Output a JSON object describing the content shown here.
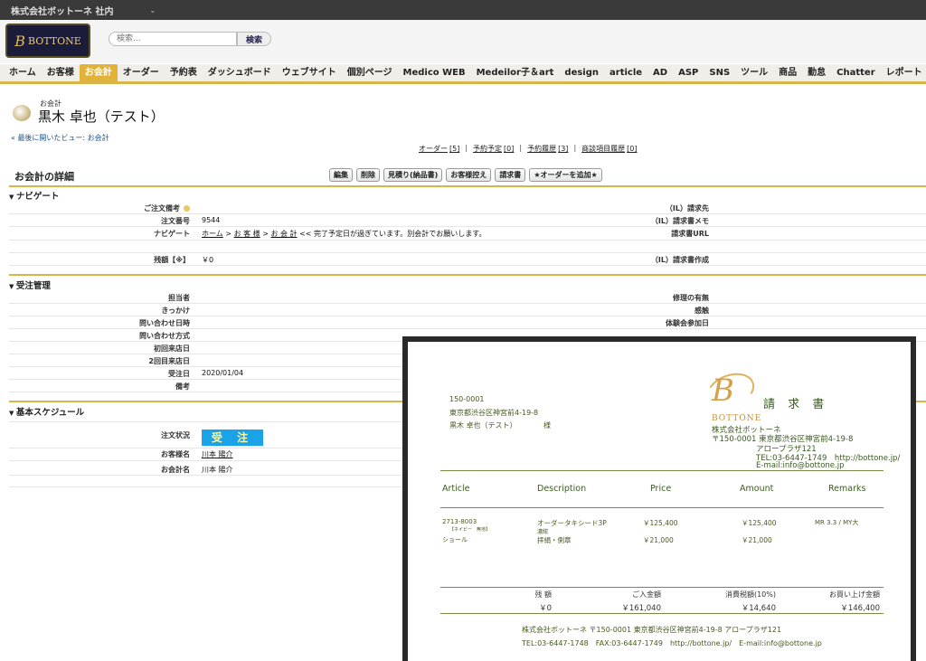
{
  "topbar": {
    "org_name": "株式会社ボットーネ 社内",
    "caret": "⌄"
  },
  "header": {
    "logo_mark": "B",
    "logo_text": "BOTTONE",
    "search_placeholder": "検索...",
    "search_button": "検索"
  },
  "nav": {
    "tabs": [
      "ホーム",
      "お客様",
      "お会計",
      "オーダー",
      "予約表",
      "ダッシュボード",
      "ウェブサイト",
      "個別ページ",
      "Medico WEB",
      "Medeilor子＆art",
      "design",
      "article",
      "AD",
      "ASP",
      "SNS",
      "ツール",
      "商品",
      "勤怠",
      "Chatter",
      "レポート",
      "仕入業者"
    ],
    "active": "お会計"
  },
  "page": {
    "subtitle": "お会計",
    "title": "黒木 卓也（テスト）",
    "back_link": "« 最後に開いたビュー: お会計"
  },
  "related": [
    {
      "label": "オーダー",
      "count": "[5]"
    },
    {
      "label": "予約予定",
      "count": "[0]"
    },
    {
      "label": "予約履歴",
      "count": "[3]"
    },
    {
      "label": "商談項目履歴",
      "count": "[0]"
    }
  ],
  "detail": {
    "title": "お会計の詳細",
    "buttons": [
      "編集",
      "削除",
      "見積り(納品書)",
      "お客様控え",
      "請求書",
      "★オーダーを追加★"
    ]
  },
  "sections": {
    "navigate": {
      "title": "ナビゲート",
      "rows": {
        "memo_label": "ご注文備考",
        "order_no_label": "注文番号",
        "order_no": "9544",
        "nav_label": "ナビゲート",
        "nav_home": "ホーム",
        "nav_customer": "お 客 様",
        "nav_account": "お 会 計",
        "nav_note": "<< 完了予定日が過ぎています。別会計でお願いします。",
        "balance_label": "残額【※】",
        "balance": "￥0",
        "right1": "（IL）請求先",
        "right2": "（IL）請求書メモ",
        "right3": "請求書URL",
        "right4": "（IL）請求書作成"
      }
    },
    "order_mgmt": {
      "title": "受注管理",
      "labels": [
        "担当者",
        "きっかけ",
        "問い合わせ日時",
        "問い合わせ方式",
        "初回来店日",
        "2回目来店日",
        "受注日",
        "備考"
      ],
      "order_date": "2020/01/04",
      "right_labels": [
        "修理の有無",
        "感触",
        "体験会参加日"
      ]
    },
    "schedule": {
      "title": "基本スケジュール",
      "status_label": "注文状況",
      "status": "受 注",
      "customer_label": "お客様名",
      "customer": "川本 陽介",
      "account_label": "お会計名",
      "account": "川本 陽介"
    }
  },
  "invoice": {
    "to_zip": "150-0001",
    "to_addr": "東京都渋谷区神宮前4-19-8",
    "to_name": "黒木 卓也（テスト）",
    "to_honorific": "様",
    "title": "請 求 書",
    "logo_mark": "B",
    "logo_text": "BOTTONE",
    "company": "株式会社ボットーネ",
    "company_addr1": "〒150-0001 東京都渋谷区神宮前4-19-8",
    "company_addr2": "アロープラザ121",
    "company_tel": "TEL:03-6447-1749　http://bottone.jp/",
    "company_mail": "E-mail:info@bottone.jp",
    "headers": [
      "Article",
      "Description",
      "Price",
      "Amount",
      "Remarks"
    ],
    "items": [
      {
        "article": "2713-8003",
        "article_sub": "【ネイビー　無地】",
        "desc": "オーダータキシード3P",
        "desc_sub": "濃紺",
        "price": "￥125,400",
        "amount": "￥125,400",
        "remarks": "MR 3.3 / MY大"
      },
      {
        "article": "ショール",
        "article_sub": "",
        "desc": "拝絹・側章",
        "desc_sub": "",
        "price": "￥21,000",
        "amount": "￥21,000",
        "remarks": ""
      }
    ],
    "totals_labels": [
      "お買い上げ金額",
      "消費税額(10%)",
      "ご入金額",
      "残 額"
    ],
    "totals": [
      "￥146,400",
      "￥14,640",
      "￥161,040",
      "￥0"
    ],
    "footer1": "株式会社ボットーネ 〒150-0001 東京都渋谷区神宮前4-19-8 アロープラザ121",
    "footer2": "TEL:03-6447-1748　FAX:03-6447-1749　http://bottone.jp/　E-mail:info@bottone.jp"
  }
}
